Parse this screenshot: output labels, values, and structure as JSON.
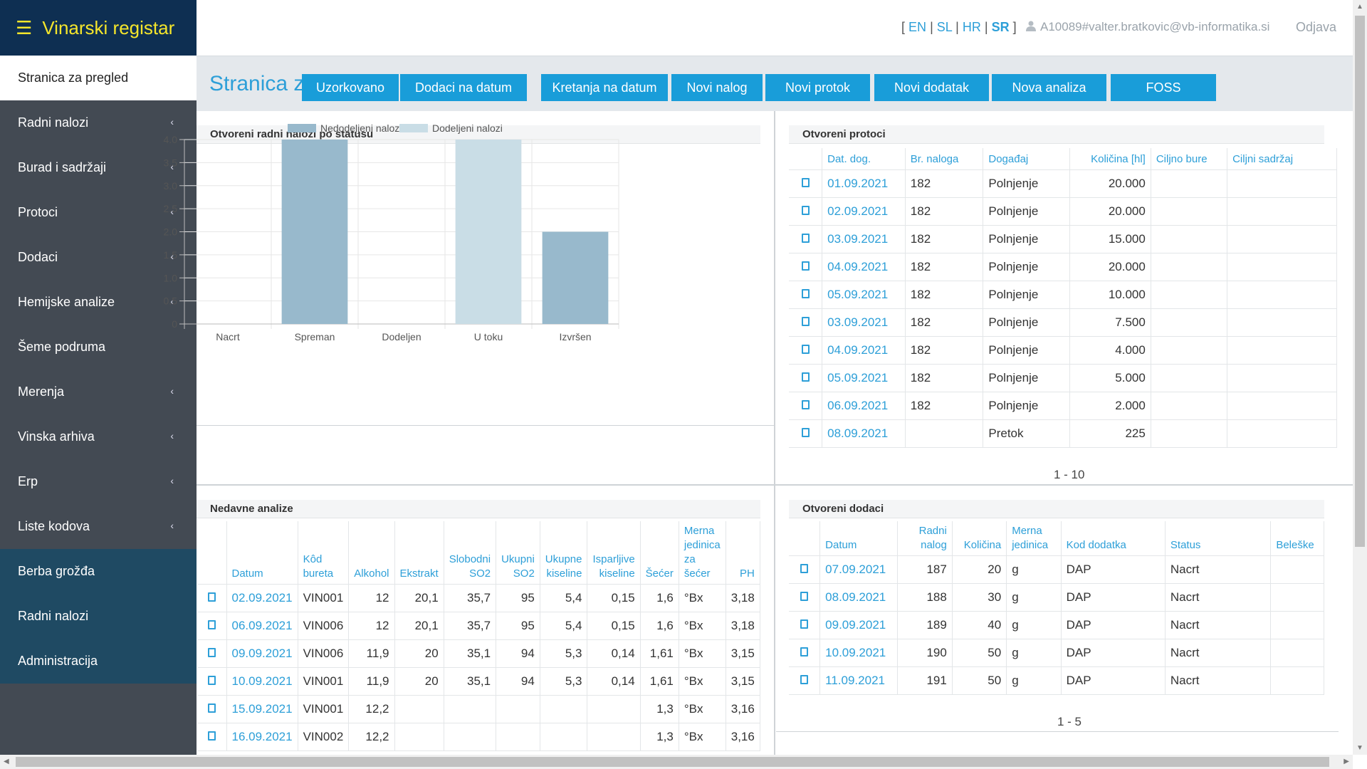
{
  "app": {
    "title": "Vinarski registar",
    "menu_icon": "hamburger-icon"
  },
  "sidebar": {
    "items": [
      {
        "label": "Stranica za pregled",
        "chevron": false,
        "active": true
      },
      {
        "label": "Radni nalozi",
        "chevron": true
      },
      {
        "label": "Burad i sadržaji",
        "chevron": true
      },
      {
        "label": "Protoci",
        "chevron": true
      },
      {
        "label": "Dodaci",
        "chevron": true
      },
      {
        "label": "Hemijske analize",
        "chevron": true
      },
      {
        "label": "Šeme podruma",
        "chevron": false
      },
      {
        "label": "Merenja",
        "chevron": true
      },
      {
        "label": "Vinska arhiva",
        "chevron": true
      },
      {
        "label": "Erp",
        "chevron": true
      },
      {
        "label": "Liste kodova",
        "chevron": true
      },
      {
        "label": "Berba grožđa",
        "chevron": false,
        "dark": true
      },
      {
        "label": "Radni nalozi",
        "chevron": false,
        "dark": true
      },
      {
        "label": "Administracija",
        "chevron": false,
        "dark": true
      }
    ],
    "chevron_glyph": "‹"
  },
  "topbar": {
    "open_bracket": "[",
    "close_bracket": "]",
    "sep": "|",
    "languages": [
      "EN",
      "SL",
      "HR",
      "SR"
    ],
    "active_language": "SR",
    "user": "A10089#valter.bratkovic@vb-informatika.si",
    "logout": "Odjava"
  },
  "header": {
    "title": "Stranica za pregled",
    "buttons": [
      "Uzorkovano",
      "Dodaci na datum",
      "Kretanja na datum",
      "Novi nalog",
      "Novi protok",
      "Novi dodatak",
      "Nova analiza",
      "FOSS"
    ]
  },
  "chart_panel": {
    "title": "Otvoreni radni nalozi po statusu"
  },
  "chart_data": {
    "type": "bar",
    "categories": [
      "Nacrt",
      "Spreman",
      "Dodeljen",
      "U toku",
      "Izvršen"
    ],
    "series": [
      {
        "name": "Nedodeljeni nalozi",
        "color": "#98b9cc",
        "values": [
          0,
          4,
          0,
          0,
          2
        ]
      },
      {
        "name": "Dodeljeni nalozi",
        "color": "#c9dde6",
        "values": [
          0,
          0,
          0,
          4,
          0
        ]
      }
    ],
    "ylim": [
      0,
      4
    ],
    "yticks": [
      "0",
      "0.5",
      "1.0",
      "1.5",
      "2.0",
      "2.5",
      "3.0",
      "3.5",
      "4.0"
    ],
    "grid": true,
    "legend": "top"
  },
  "protoci": {
    "title": "Otvoreni protoci",
    "columns": [
      "Dat. dog.",
      "Br. naloga",
      "Događaj",
      "Količina [hl]",
      "Ciljno bure",
      "Ciljni sadržaj"
    ],
    "rows": [
      [
        "01.09.2021",
        "182",
        "Polnjenje",
        "20.000",
        "",
        ""
      ],
      [
        "02.09.2021",
        "182",
        "Polnjenje",
        "20.000",
        "",
        ""
      ],
      [
        "03.09.2021",
        "182",
        "Polnjenje",
        "15.000",
        "",
        ""
      ],
      [
        "04.09.2021",
        "182",
        "Polnjenje",
        "20.000",
        "",
        ""
      ],
      [
        "05.09.2021",
        "182",
        "Polnjenje",
        "10.000",
        "",
        ""
      ],
      [
        "03.09.2021",
        "182",
        "Polnjenje",
        "7.500",
        "",
        ""
      ],
      [
        "04.09.2021",
        "182",
        "Polnjenje",
        "4.000",
        "",
        ""
      ],
      [
        "05.09.2021",
        "182",
        "Polnjenje",
        "5.000",
        "",
        ""
      ],
      [
        "06.09.2021",
        "182",
        "Polnjenje",
        "2.000",
        "",
        ""
      ],
      [
        "08.09.2021",
        "",
        "Pretok",
        "225",
        "",
        ""
      ]
    ],
    "pager": "1 - 10"
  },
  "analize": {
    "title": "Nedavne analize",
    "columns": [
      "Datum",
      "Kôd bureta",
      "Alkohol",
      "Ekstrakt",
      "Slobodni SO2",
      "Ukupni SO2",
      "Ukupne kiseline",
      "Isparljive kiseline",
      "Šećer",
      "Merna jedinica za šećer",
      "PH"
    ],
    "rows": [
      [
        "02.09.2021",
        "VIN001",
        "12",
        "20,1",
        "35,7",
        "95",
        "5,4",
        "0,15",
        "1,6",
        "°Bx",
        "3,18"
      ],
      [
        "06.09.2021",
        "VIN006",
        "12",
        "20,1",
        "35,7",
        "95",
        "5,4",
        "0,15",
        "1,6",
        "°Bx",
        "3,18"
      ],
      [
        "09.09.2021",
        "VIN006",
        "11,9",
        "20",
        "35,1",
        "94",
        "5,3",
        "0,14",
        "1,61",
        "°Bx",
        "3,15"
      ],
      [
        "10.09.2021",
        "VIN001",
        "11,9",
        "20",
        "35,1",
        "94",
        "5,3",
        "0,14",
        "1,61",
        "°Bx",
        "3,15"
      ],
      [
        "15.09.2021",
        "VIN001",
        "12,2",
        "",
        "",
        "",
        "",
        "",
        "1,3",
        "°Bx",
        "3,16"
      ],
      [
        "16.09.2021",
        "VIN002",
        "12,2",
        "",
        "",
        "",
        "",
        "",
        "1,3",
        "°Bx",
        "3,16"
      ]
    ]
  },
  "dodaci": {
    "title": "Otvoreni dodaci",
    "columns": [
      "Datum",
      "Radni nalog",
      "Količina",
      "Merna jedinica",
      "Kod dodatka",
      "Status",
      "Beleške"
    ],
    "rows": [
      [
        "07.09.2021",
        "187",
        "20",
        "g",
        "DAP",
        "Nacrt",
        ""
      ],
      [
        "08.09.2021",
        "188",
        "30",
        "g",
        "DAP",
        "Nacrt",
        ""
      ],
      [
        "09.09.2021",
        "189",
        "40",
        "g",
        "DAP",
        "Nacrt",
        ""
      ],
      [
        "10.09.2021",
        "190",
        "50",
        "g",
        "DAP",
        "Nacrt",
        ""
      ],
      [
        "11.09.2021",
        "191",
        "50",
        "g",
        "DAP",
        "Nacrt",
        ""
      ]
    ],
    "pager": "1 - 5"
  }
}
